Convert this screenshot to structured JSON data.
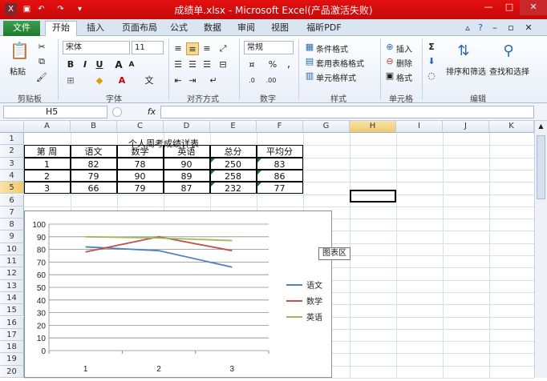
{
  "window": {
    "title": "成绩单.xlsx - Microsoft Excel(产品激活失败)"
  },
  "tabs": {
    "file": "文件",
    "items": [
      "开始",
      "插入",
      "页面布局",
      "公式",
      "数据",
      "审阅",
      "视图",
      "福昕PDF"
    ]
  },
  "ribbon": {
    "clipboard": {
      "label": "剪贴板",
      "paste": "粘贴"
    },
    "font": {
      "label": "字体",
      "name": "宋体",
      "size": "11",
      "bold": "B",
      "italic": "I",
      "underline": "U",
      "wen": "文",
      "a": "A"
    },
    "alignment": {
      "label": "对齐方式"
    },
    "number": {
      "label": "数字",
      "format": "常规",
      "percent": "%"
    },
    "styles": {
      "label": "样式",
      "conditional": "条件格式",
      "table": "套用表格格式",
      "cell": "单元格样式"
    },
    "cells": {
      "label": "单元格",
      "insert": "插入",
      "delete": "删除",
      "format": "格式"
    },
    "editing": {
      "label": "编辑",
      "sort": "排序和筛选",
      "find": "查找和选择",
      "sigma": "Σ"
    }
  },
  "formula_bar": {
    "name_box": "H5",
    "fx": "fx",
    "value": ""
  },
  "columns": [
    "A",
    "B",
    "C",
    "D",
    "E",
    "F",
    "G",
    "H",
    "I",
    "J",
    "K"
  ],
  "rows": [
    "1",
    "2",
    "3",
    "4",
    "5",
    "6",
    "7",
    "8",
    "9",
    "10",
    "11",
    "12",
    "13",
    "14",
    "15",
    "16",
    "17",
    "18",
    "19",
    "20"
  ],
  "sheet": {
    "title": "个人周考成绩详表",
    "headers": [
      "第  周",
      "语文",
      "数学",
      "英语",
      "总分",
      "平均分"
    ],
    "data": [
      [
        "1",
        "82",
        "78",
        "90",
        "250",
        "83"
      ],
      [
        "2",
        "79",
        "90",
        "89",
        "258",
        "86"
      ],
      [
        "3",
        "66",
        "79",
        "87",
        "232",
        "77"
      ]
    ]
  },
  "tooltip": "图表区",
  "chart_data": {
    "type": "line",
    "categories": [
      "1",
      "2",
      "3"
    ],
    "series": [
      {
        "name": "语文",
        "values": [
          82,
          79,
          66
        ],
        "color": "#4f81bd"
      },
      {
        "name": "数学",
        "values": [
          78,
          90,
          79
        ],
        "color": "#c0504d"
      },
      {
        "name": "英语",
        "values": [
          90,
          89,
          87
        ],
        "color": "#9bbb59"
      }
    ],
    "ylim": [
      0,
      100
    ],
    "yticks": [
      "0",
      "10",
      "20",
      "30",
      "40",
      "50",
      "60",
      "70",
      "80",
      "90",
      "100"
    ],
    "grid": true,
    "legend": "right"
  }
}
